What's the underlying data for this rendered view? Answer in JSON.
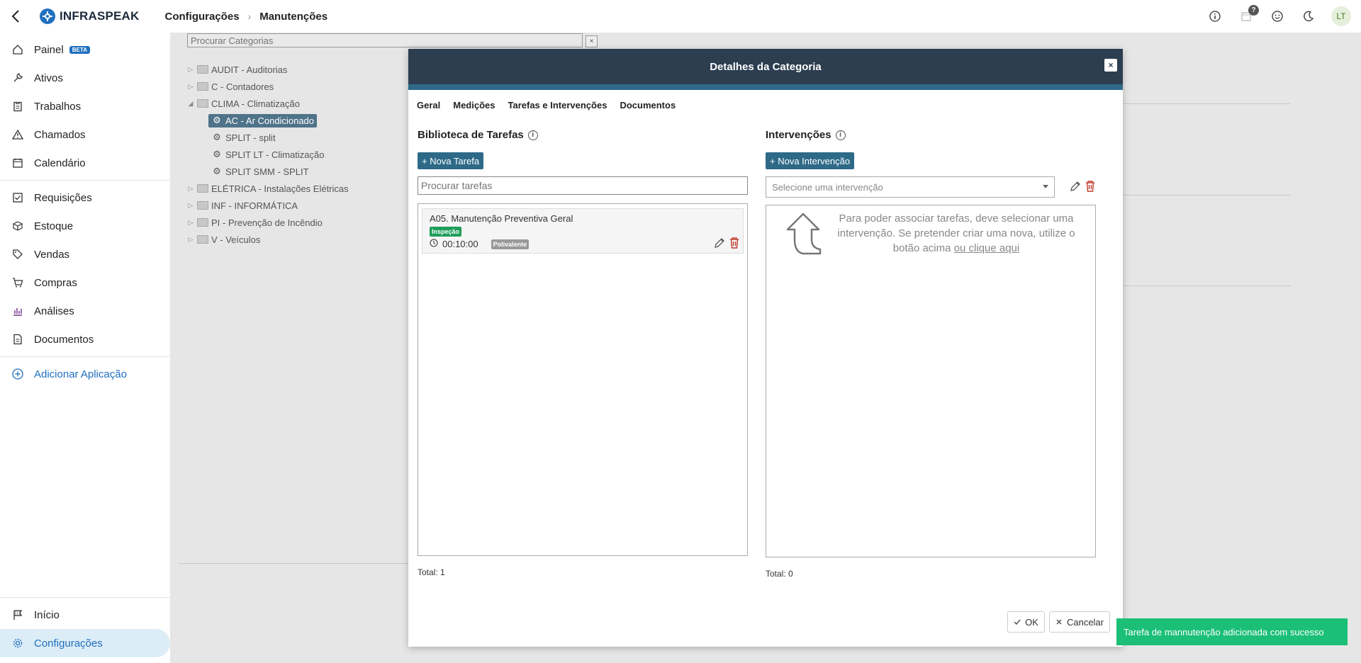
{
  "app": {
    "name": "INFRASPEAK"
  },
  "breadcrumb": {
    "section": "Configurações",
    "page": "Manutenções"
  },
  "topbar": {
    "help_badge": "?",
    "avatar_initials": "LT"
  },
  "sidebar": {
    "items": [
      {
        "label": "Painel",
        "badge": "BETA",
        "icon": "home-icon"
      },
      {
        "label": "Ativos",
        "icon": "wrench-icon"
      },
      {
        "label": "Trabalhos",
        "icon": "clipboard-icon"
      },
      {
        "label": "Chamados",
        "icon": "warning-icon"
      },
      {
        "label": "Calendário",
        "icon": "calendar-icon"
      },
      {
        "label": "Requisições",
        "icon": "checklist-icon"
      },
      {
        "label": "Estoque",
        "icon": "box-icon"
      },
      {
        "label": "Vendas",
        "icon": "tag-icon"
      },
      {
        "label": "Compras",
        "icon": "cart-icon"
      },
      {
        "label": "Análises",
        "icon": "bar-chart-icon"
      },
      {
        "label": "Documentos",
        "icon": "document-icon"
      }
    ],
    "add_app": "Adicionar Aplicação",
    "bottom": [
      {
        "label": "Início",
        "icon": "flag-icon"
      },
      {
        "label": "Configurações",
        "icon": "gear-icon"
      }
    ]
  },
  "categories": {
    "search_placeholder": "Procurar Categorias",
    "clear_label": "×",
    "tree": [
      {
        "label": "AUDIT - Auditorias",
        "level": 0,
        "state": "collapsed"
      },
      {
        "label": "C - Contadores",
        "level": 0,
        "state": "collapsed"
      },
      {
        "label": "CLIMA - Climatização",
        "level": 0,
        "state": "expanded"
      },
      {
        "label": "AC - Ar Condicionado",
        "level": 1,
        "selected": true
      },
      {
        "label": "SPLIT - split",
        "level": 1
      },
      {
        "label": "SPLIT LT - Climatização",
        "level": 1
      },
      {
        "label": "SPLIT SMM - SPLIT",
        "level": 1
      },
      {
        "label": "ELÉTRICA - Instalações Elétricas",
        "level": 0,
        "state": "collapsed"
      },
      {
        "label": "INF - INFORMÁTICA",
        "level": 0,
        "state": "collapsed"
      },
      {
        "label": "PI - Prevenção de Incêndio",
        "level": 0,
        "state": "collapsed"
      },
      {
        "label": "V - Veículos",
        "level": 0,
        "state": "collapsed"
      }
    ]
  },
  "modal": {
    "title": "Detalhes da Categoria",
    "close": "×",
    "tabs": [
      "Geral",
      "Medições",
      "Tarefas e Intervenções",
      "Documentos"
    ],
    "library": {
      "title": "Biblioteca de Tarefas",
      "new_button": "+ Nova Tarefa",
      "search_placeholder": "Procurar tarefas",
      "tasks": [
        {
          "name": "A05. Manutenção Preventiva Geral",
          "type": "Inspeção",
          "duration": "00:10:00",
          "skill": "Polivalente"
        }
      ],
      "total": "Total: 1"
    },
    "interventions": {
      "title": "Intervenções",
      "new_button": "+ Nova Intervenção",
      "select_placeholder": "Selecione uma intervenção",
      "hint": "Para poder associar tarefas, deve selecionar uma intervenção. Se pretender criar uma nova, utilize o botão acima",
      "hint_link": "ou clique aqui",
      "total": "Total: 0"
    },
    "ok": "OK",
    "cancel": "Cancelar"
  },
  "toast": {
    "message": "Tarefa de mannutenção adicionada com sucesso",
    "color": "#1bbf77"
  },
  "colors": {
    "accent": "#1f6fbf",
    "modal_header": "#2c3e50",
    "button": "#2e6a88"
  }
}
